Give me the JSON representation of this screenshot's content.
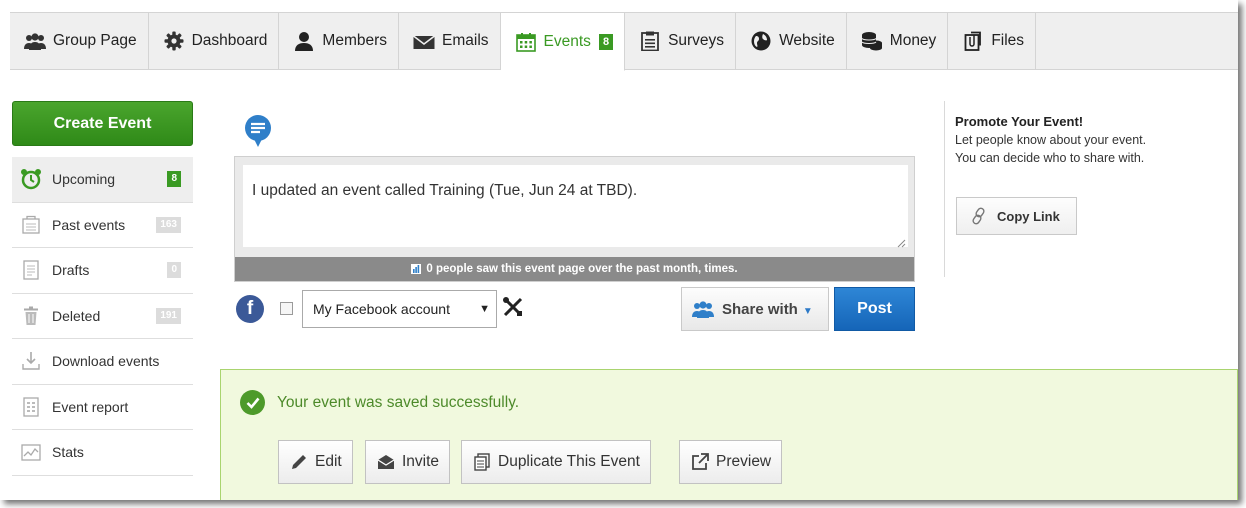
{
  "nav": {
    "tabs": [
      {
        "label": "Group Page",
        "icon": "group-icon"
      },
      {
        "label": "Dashboard",
        "icon": "gear-icon"
      },
      {
        "label": "Members",
        "icon": "person-icon"
      },
      {
        "label": "Emails",
        "icon": "envelope-icon"
      },
      {
        "label": "Events",
        "icon": "calendar-icon",
        "badge": "8",
        "active": true
      },
      {
        "label": "Surveys",
        "icon": "clipboard-icon"
      },
      {
        "label": "Website",
        "icon": "globe-icon"
      },
      {
        "label": "Money",
        "icon": "coins-icon"
      },
      {
        "label": "Files",
        "icon": "files-icon"
      }
    ]
  },
  "sidebar": {
    "create_label": "Create Event",
    "items": [
      {
        "label": "Upcoming",
        "count": "8",
        "icon": "alarm-clock-icon",
        "active": true
      },
      {
        "label": "Past events",
        "count": "163",
        "icon": "past-events-icon"
      },
      {
        "label": "Drafts",
        "count": "0",
        "icon": "drafts-icon"
      },
      {
        "label": "Deleted",
        "count": "191",
        "icon": "trash-icon"
      },
      {
        "label": "Download events",
        "icon": "download-icon"
      },
      {
        "label": "Event report",
        "icon": "report-icon"
      },
      {
        "label": "Stats",
        "icon": "stats-icon"
      }
    ]
  },
  "composer": {
    "text": "I updated an event called Training (Tue, Jun 24 at TBD).",
    "seen_text": "0 people saw this event page over the past month, times.",
    "fb_account": "My Facebook account",
    "share_label": "Share with",
    "post_label": "Post"
  },
  "promote": {
    "title": "Promote Your Event!",
    "line1": "Let people know about your event.",
    "line2": "You can decide who to share with.",
    "copy_link": "Copy Link"
  },
  "success": {
    "message": "Your event was saved successfully.",
    "actions": {
      "edit": "Edit",
      "invite": "Invite",
      "duplicate": "Duplicate This Event",
      "preview": "Preview"
    }
  },
  "colors": {
    "accent_green": "#3a9a23",
    "post_blue": "#1a6fc4",
    "success_bg": "#f1f9de"
  }
}
